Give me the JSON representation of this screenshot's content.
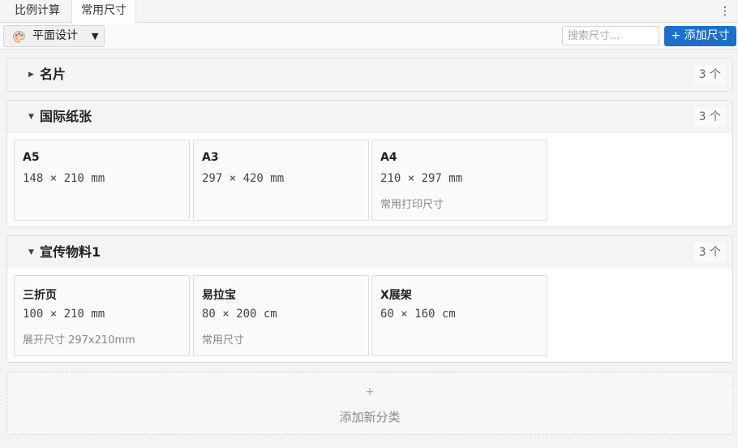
{
  "tabs": [
    {
      "label": "比例计算"
    },
    {
      "label": "常用尺寸"
    }
  ],
  "menu_icon": "kebab-icon",
  "toolbar": {
    "category_select": {
      "label": "平面设计",
      "icon": "palette-icon"
    },
    "search_placeholder": "搜索尺寸...",
    "add_button_label": "+ 添加尺寸",
    "accent_color": "#1e6fcc"
  },
  "categories": [
    {
      "title": "名片",
      "count": "3 个",
      "expanded": false,
      "items": []
    },
    {
      "title": "国际纸张",
      "count": "3 个",
      "expanded": true,
      "items": [
        {
          "name": "A5",
          "dims": "148 × 210 mm",
          "note": ""
        },
        {
          "name": "A3",
          "dims": "297 × 420 mm",
          "note": ""
        },
        {
          "name": "A4",
          "dims": "210 × 297 mm",
          "note": "常用打印尺寸"
        }
      ]
    },
    {
      "title": "宣传物料1",
      "count": "3 个",
      "expanded": true,
      "items": [
        {
          "name": "三折页",
          "dims": "100 × 210 mm",
          "note": "展开尺寸 297x210mm"
        },
        {
          "name": "易拉宝",
          "dims": "80 × 200 cm",
          "note": "常用尺寸"
        },
        {
          "name": "X展架",
          "dims": "60 × 160 cm",
          "note": ""
        }
      ]
    }
  ],
  "add_category": {
    "plus": "+",
    "label": "添加新分类"
  }
}
